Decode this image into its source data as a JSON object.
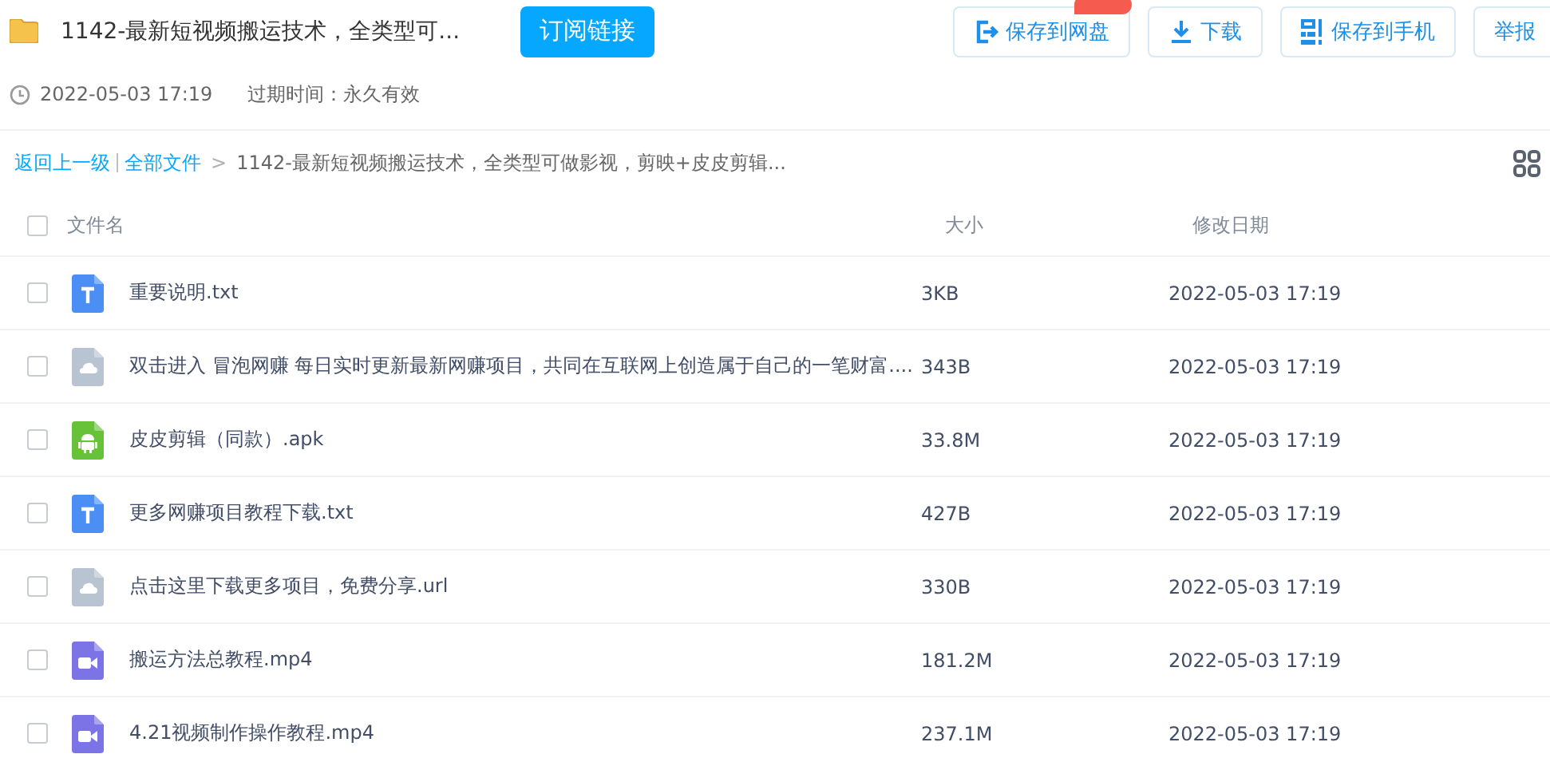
{
  "header": {
    "title": "1142-最新短视频搬运技术，全类型可...",
    "subscribe_button": "订阅链接",
    "actions": [
      {
        "kind": "save",
        "label": "保存到网盘",
        "promo": true
      },
      {
        "kind": "download",
        "label": "下载",
        "promo": false
      },
      {
        "kind": "phone",
        "label": "保存到手机",
        "promo": false
      },
      {
        "kind": "report",
        "label": "举报",
        "promo": false
      }
    ],
    "created": "2022-05-03 17:19",
    "expiry": "过期时间：永久有效"
  },
  "breadcrumb": {
    "back": "返回上一级",
    "root": "全部文件",
    "separator": ">",
    "current": "1142-最新短视频搬运技术，全类型可做影视，剪映+皮皮剪辑..."
  },
  "table": {
    "columns": [
      "文件名",
      "大小",
      "修改日期"
    ],
    "all_checked": false,
    "rows": [
      {
        "kind": "txt",
        "name": "重要说明.txt",
        "size": "3KB",
        "date": "2022-05-03 17:19",
        "checked": false
      },
      {
        "kind": "url",
        "name": "双击进入 冒泡网赚 每日实时更新最新网赚项目，共同在互联网上创造属于自己的一笔财富....",
        "size": "343B",
        "date": "2022-05-03 17:19",
        "checked": false
      },
      {
        "kind": "apk",
        "name": "皮皮剪辑（同款）.apk",
        "size": "33.8M",
        "date": "2022-05-03 17:19",
        "checked": false
      },
      {
        "kind": "txt",
        "name": "更多网赚项目教程下载.txt",
        "size": "427B",
        "date": "2022-05-03 17:19",
        "checked": false
      },
      {
        "kind": "url",
        "name": "点击这里下载更多项目，免费分享.url",
        "size": "330B",
        "date": "2022-05-03 17:19",
        "checked": false
      },
      {
        "kind": "video",
        "name": "搬运方法总教程.mp4",
        "size": "181.2M",
        "date": "2022-05-03 17:19",
        "checked": false
      },
      {
        "kind": "video",
        "name": "4.21视频制作操作教程.mp4",
        "size": "237.1M",
        "date": "2022-05-03 17:19",
        "checked": false
      }
    ]
  }
}
